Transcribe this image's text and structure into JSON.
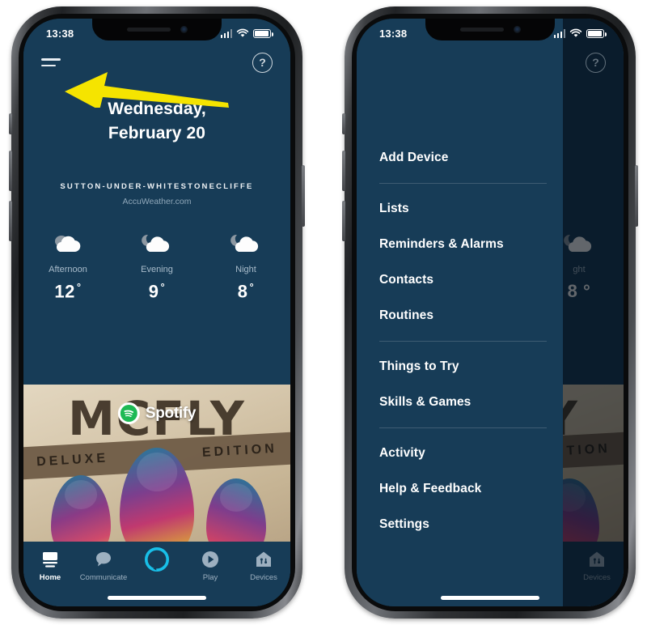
{
  "status_bar": {
    "time": "13:38",
    "signal_icon": "cellular-signal-icon",
    "wifi_icon": "wifi-icon",
    "battery_icon": "battery-icon"
  },
  "left_phone": {
    "top_bar": {
      "menu_icon": "hamburger-menu-icon",
      "help_icon": "help-question-icon",
      "help_label": "?"
    },
    "date": {
      "line1": "Wednesday,",
      "line2": "February 20"
    },
    "weather": {
      "location": "SUTTON-UNDER-WHITESTONECLIFFE",
      "source": "AccuWeather.com",
      "forecast": [
        {
          "label": "Afternoon",
          "temp": "12",
          "degree": "°",
          "icon": "cloudy-icon"
        },
        {
          "label": "Evening",
          "temp": "9",
          "degree": "°",
          "icon": "partly-cloudy-night-icon"
        },
        {
          "label": "Night",
          "temp": "8",
          "degree": "°",
          "icon": "partly-cloudy-night-icon"
        }
      ]
    },
    "album_card": {
      "artist": "MCFLY",
      "edition_left": "DELUXE",
      "edition_right": "EDITION",
      "provider": "Spotify",
      "provider_icon": "spotify-icon"
    },
    "tab_bar": [
      {
        "label": "Home",
        "icon": "home-echo-icon",
        "active": true
      },
      {
        "label": "Communicate",
        "icon": "chat-bubble-icon",
        "active": false
      },
      {
        "label": "",
        "icon": "alexa-ring-icon",
        "active": false
      },
      {
        "label": "Play",
        "icon": "play-circle-icon",
        "active": false
      },
      {
        "label": "Devices",
        "icon": "devices-home-icon",
        "active": false
      }
    ]
  },
  "right_phone": {
    "top_bar": {
      "help_icon": "help-question-icon",
      "help_label": "?"
    },
    "drawer": {
      "groups": [
        {
          "items": [
            "Add Device"
          ]
        },
        {
          "items": [
            "Lists",
            "Reminders & Alarms",
            "Contacts",
            "Routines"
          ]
        },
        {
          "items": [
            "Things to Try",
            "Skills & Games"
          ]
        },
        {
          "items": [
            "Activity",
            "Help & Feedback",
            "Settings"
          ]
        }
      ],
      "highlighted_item": "Settings"
    },
    "background_peek": {
      "forecast_label": "ght",
      "forecast_temp": "8 °",
      "tab_label": "Devices"
    }
  },
  "annotations": {
    "arrow_color": "#F5E400",
    "ellipse_color": "#F5E400",
    "arrow_target": "hamburger-menu-icon",
    "ellipse_target": "Settings"
  },
  "colors": {
    "app_background": "#173C57",
    "accent_cyan": "#18BFE8",
    "highlight_yellow": "#F5E400",
    "page_background": "#FFFFFF"
  }
}
